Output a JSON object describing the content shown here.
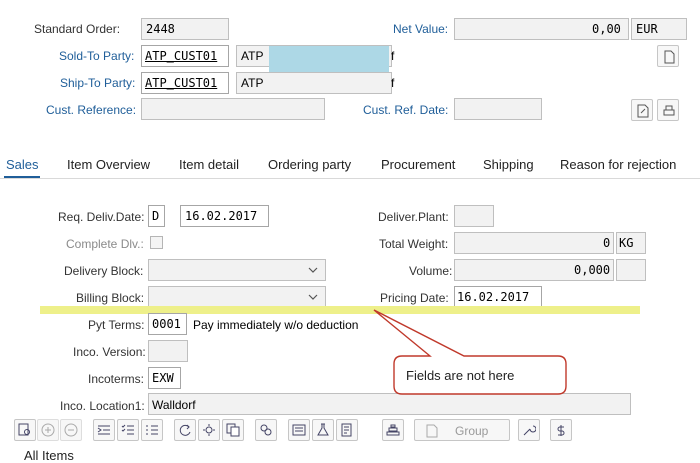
{
  "header": {
    "standard_order_label": "Standard Order:",
    "standard_order_value": "2448",
    "net_value_label": "Net Value:",
    "net_value": "0,00",
    "currency": "EUR",
    "sold_to_label": "Sold-To Party:",
    "sold_to_value": "ATP_CUST01",
    "sold_to_name_start": "ATP",
    "sold_to_name_end": "f",
    "ship_to_label": "Ship-To Party:",
    "ship_to_value": "ATP_CUST01",
    "ship_to_name_start": "ATP",
    "ship_to_name_end": "f",
    "cust_reference_label": "Cust. Reference:",
    "cust_ref_date_label": "Cust. Ref. Date:"
  },
  "tabs": [
    {
      "label": "Sales",
      "active": true
    },
    {
      "label": "Item Overview"
    },
    {
      "label": "Item detail"
    },
    {
      "label": "Ordering party"
    },
    {
      "label": "Procurement"
    },
    {
      "label": "Shipping"
    },
    {
      "label": "Reason for rejection"
    }
  ],
  "sales": {
    "req_deliv_date_label": "Req. Deliv.Date:",
    "req_deliv_date_type": "D",
    "req_deliv_date": "16.02.2017",
    "deliver_plant_label": "Deliver.Plant:",
    "complete_dlv_label": "Complete Dlv.:",
    "total_weight_label": "Total Weight:",
    "total_weight_value": "0",
    "total_weight_unit": "KG",
    "delivery_block_label": "Delivery Block:",
    "volume_label": "Volume:",
    "volume_value": "0,000",
    "billing_block_label": "Billing Block:",
    "pricing_date_label": "Pricing Date:",
    "pricing_date": "16.02.2017",
    "pyt_terms_label": "Pyt Terms:",
    "pyt_terms_value": "0001",
    "pyt_terms_text": "Pay immediately w/o deduction",
    "inco_version_label": "Inco. Version:",
    "incoterms_label": "Incoterms:",
    "incoterms_value": "EXW",
    "inco_location_label": "Inco. Location1:",
    "inco_location_value": "Walldorf"
  },
  "annotation": {
    "callout_text": "Fields are not here",
    "highlight_color": "#eef08a",
    "callout_border_color": "#c0392b"
  },
  "toolbar": {
    "group_label": "Group"
  },
  "items": {
    "all_items_label": "All Items"
  },
  "colors": {
    "label_blue": "#1f5e99",
    "field_bg": "#f2f2f2",
    "redacted": "#add8e6"
  }
}
